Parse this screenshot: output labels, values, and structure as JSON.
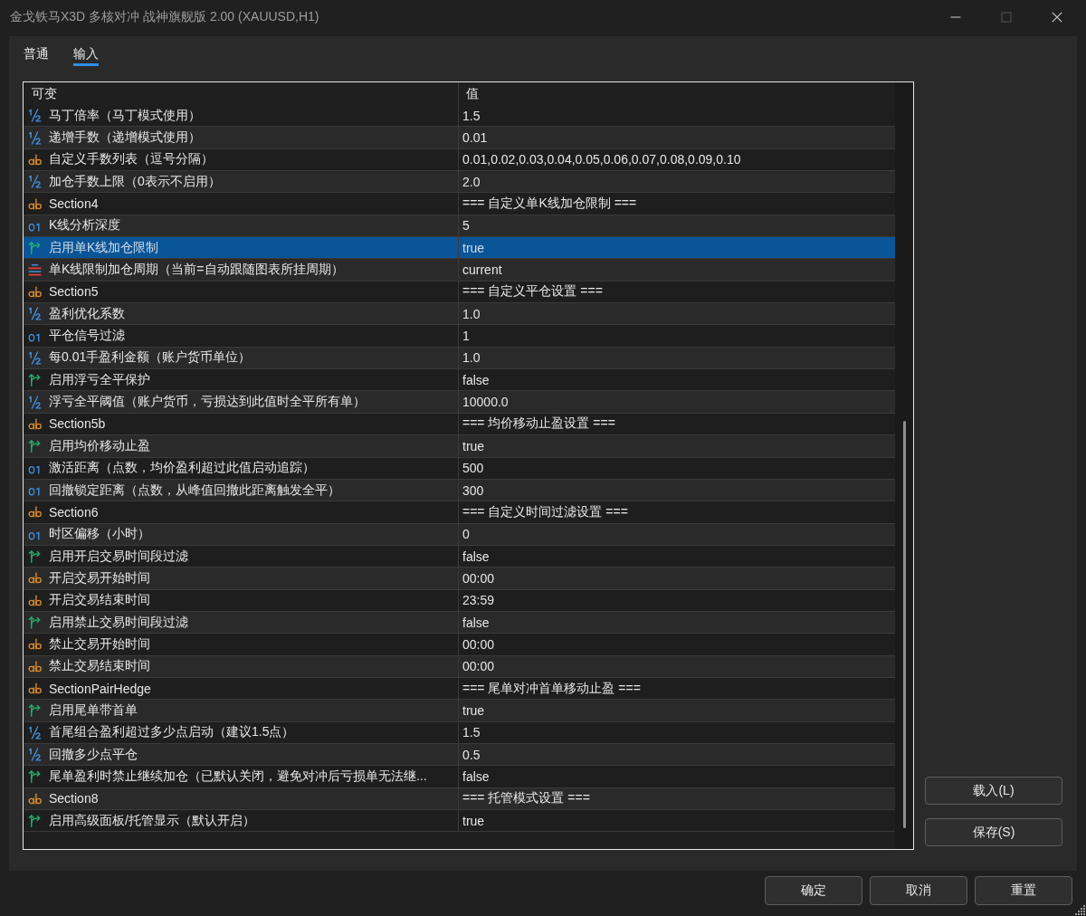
{
  "window": {
    "title": "金戈铁马X3D 多核对冲 战神旗舰版 2.00 (XAUUSD,H1)",
    "maximize_disabled": true
  },
  "tabs": [
    {
      "label": "普通",
      "selected": false
    },
    {
      "label": "输入",
      "selected": true
    }
  ],
  "table": {
    "columns": [
      "可变",
      "值"
    ],
    "rows": [
      {
        "kind": "double",
        "name": "马丁倍率（马丁模式使用）",
        "value": "1.5",
        "selected": false
      },
      {
        "kind": "double",
        "name": "递增手数（递增模式使用）",
        "value": "0.01",
        "selected": false
      },
      {
        "kind": "string",
        "name": "自定义手数列表（逗号分隔）",
        "value": "0.01,0.02,0.03,0.04,0.05,0.06,0.07,0.08,0.09,0.10",
        "selected": false
      },
      {
        "kind": "double",
        "name": "加仓手数上限（0表示不启用）",
        "value": "2.0",
        "selected": false
      },
      {
        "kind": "string",
        "name": "Section4",
        "value": "=== 自定义单K线加仓限制 ===",
        "selected": false
      },
      {
        "kind": "int",
        "name": "K线分析深度",
        "value": "5",
        "selected": false
      },
      {
        "kind": "bool",
        "name": "启用单K线加仓限制",
        "value": "true",
        "selected": true
      },
      {
        "kind": "enum",
        "name": "单K线限制加仓周期（当前=自动跟随图表所挂周期）",
        "value": "current",
        "selected": false
      },
      {
        "kind": "string",
        "name": "Section5",
        "value": "=== 自定义平仓设置 ===",
        "selected": false
      },
      {
        "kind": "double",
        "name": "盈利优化系数",
        "value": "1.0",
        "selected": false
      },
      {
        "kind": "int",
        "name": "平仓信号过滤",
        "value": "1",
        "selected": false
      },
      {
        "kind": "double",
        "name": "每0.01手盈利金额（账户货币单位）",
        "value": "1.0",
        "selected": false
      },
      {
        "kind": "bool",
        "name": "启用浮亏全平保护",
        "value": "false",
        "selected": false
      },
      {
        "kind": "double",
        "name": "浮亏全平阈值（账户货币，亏损达到此值时全平所有单）",
        "value": "10000.0",
        "selected": false
      },
      {
        "kind": "string",
        "name": "Section5b",
        "value": "=== 均价移动止盈设置 ===",
        "selected": false
      },
      {
        "kind": "bool",
        "name": "启用均价移动止盈",
        "value": "true",
        "selected": false
      },
      {
        "kind": "int",
        "name": "激活距离（点数，均价盈利超过此值启动追踪）",
        "value": "500",
        "selected": false
      },
      {
        "kind": "int",
        "name": "回撤锁定距离（点数，从峰值回撤此距离触发全平）",
        "value": "300",
        "selected": false
      },
      {
        "kind": "string",
        "name": "Section6",
        "value": "=== 自定义时间过滤设置 ===",
        "selected": false
      },
      {
        "kind": "int",
        "name": "时区偏移（小时）",
        "value": "0",
        "selected": false
      },
      {
        "kind": "bool",
        "name": "启用开启交易时间段过滤",
        "value": "false",
        "selected": false
      },
      {
        "kind": "string",
        "name": "开启交易开始时间",
        "value": "00:00",
        "selected": false
      },
      {
        "kind": "string",
        "name": "开启交易结束时间",
        "value": "23:59",
        "selected": false
      },
      {
        "kind": "bool",
        "name": "启用禁止交易时间段过滤",
        "value": "false",
        "selected": false
      },
      {
        "kind": "string",
        "name": "禁止交易开始时间",
        "value": "00:00",
        "selected": false
      },
      {
        "kind": "string",
        "name": "禁止交易结束时间",
        "value": "00:00",
        "selected": false
      },
      {
        "kind": "string",
        "name": "SectionPairHedge",
        "value": "=== 尾单对冲首单移动止盈 ===",
        "selected": false
      },
      {
        "kind": "bool",
        "name": "启用尾单带首单",
        "value": "true",
        "selected": false
      },
      {
        "kind": "double",
        "name": "首尾组合盈利超过多少点启动（建议1.5点）",
        "value": "1.5",
        "selected": false
      },
      {
        "kind": "double",
        "name": "回撤多少点平仓",
        "value": "0.5",
        "selected": false
      },
      {
        "kind": "bool",
        "name": "尾单盈利时禁止继续加仓（已默认关闭，避免对冲后亏损单无法继...",
        "value": "false",
        "selected": false
      },
      {
        "kind": "string",
        "name": "Section8",
        "value": "=== 托管模式设置 ===",
        "selected": false
      },
      {
        "kind": "bool",
        "name": "启用高级面板/托管显示（默认开启）",
        "value": "true",
        "selected": false
      }
    ]
  },
  "side_buttons": [
    "载入(L)",
    "保存(S)"
  ],
  "footer_buttons": [
    "确定",
    "取消",
    "重置"
  ]
}
